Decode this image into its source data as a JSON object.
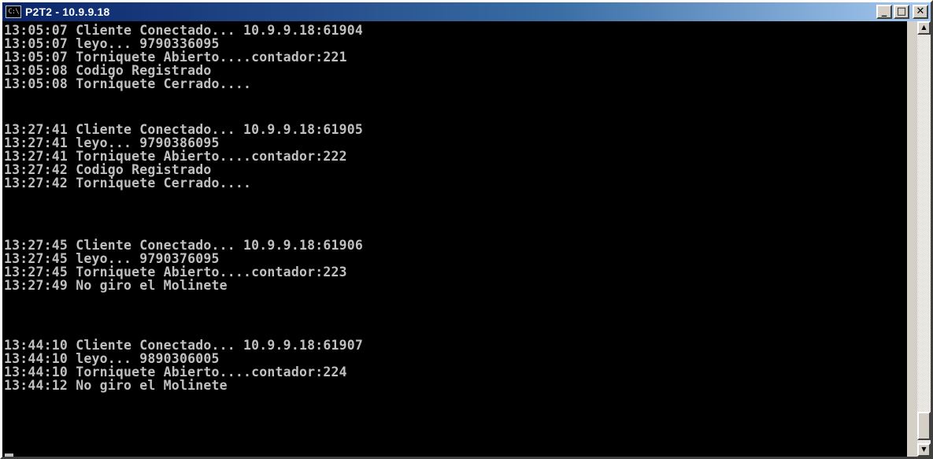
{
  "window": {
    "title": "P2T2 - 10.9.9.18",
    "icon": "cmd-console-icon",
    "icon_text": "C:\\",
    "buttons": {
      "minimize": "_",
      "maximize": "□",
      "close": "✕"
    }
  },
  "console": {
    "text_color": "#c0c0c0",
    "background": "#000000",
    "lines": [
      "13:05:07 Cliente Conectado... 10.9.9.18:61904",
      "13:05:07 leyo... 9790336095",
      "13:05:07 Torniquete Abierto....contador:221",
      "13:05:08 Codigo Registrado",
      "13:05:08 Torniquete Cerrado....",
      "",
      "",
      "13:27:41 Cliente Conectado... 10.9.9.18:61905",
      "13:27:41 leyo... 9790386095",
      "13:27:41 Torniquete Abierto....contador:222",
      "13:27:42 Codigo Registrado",
      "13:27:42 Torniquete Cerrado....",
      "",
      "",
      "13:27:45 Cliente Conectado... 10.9.9.18:61906",
      "13:27:45 leyo... 9790376095",
      "13:27:45 Torniquete Abierto....contador:223",
      "13:27:49 No giro el Molinete",
      "",
      "",
      "13:44:10 Cliente Conectado... 10.9.9.18:61907",
      "13:44:10 leyo... 9890306005",
      "13:44:10 Torniquete Abierto....contador:224",
      "13:44:12 No giro el Molinete"
    ]
  },
  "scrollbar": {
    "up_arrow": "▲",
    "down_arrow": "▼"
  }
}
